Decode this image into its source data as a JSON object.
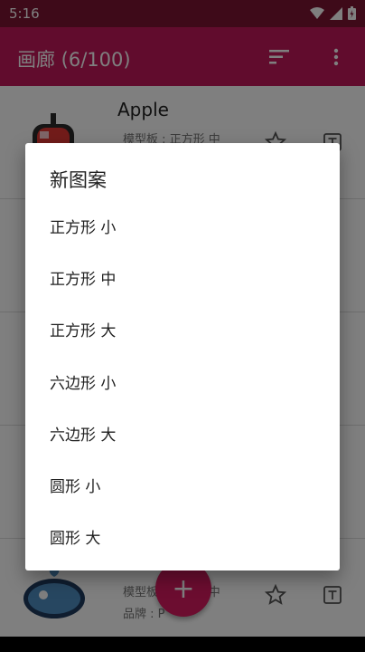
{
  "status_bar": {
    "time": "5:16"
  },
  "app_bar": {
    "title": "画廊 (6/100)",
    "sort_icon": "sort-icon",
    "menu_icon": "more-vert-icon"
  },
  "list": {
    "items": [
      {
        "title": "Apple",
        "subtitle1": "模型板 : 正方形 中"
      },
      {
        "title": "",
        "subtitle1": "模型板 : 正方形 中",
        "subtitle2": "品牌 : P"
      }
    ]
  },
  "dialog": {
    "title": "新图案",
    "options": [
      "正方形 小",
      "正方形 中",
      "正方形 大",
      "六边形 小",
      "六边形 大",
      "圆形 小",
      "圆形 大"
    ]
  },
  "fab": {
    "label": "+"
  },
  "colors": {
    "primary": "#c2185b",
    "primary_dark": "#7d1433",
    "accent": "#d81b60"
  }
}
